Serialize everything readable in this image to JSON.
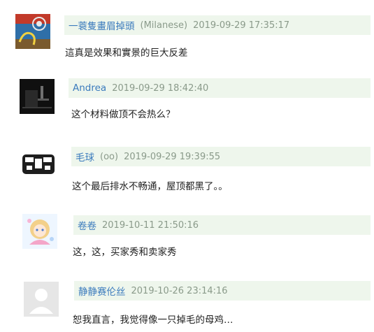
{
  "comments": [
    {
      "name": "一蓑隻畫眉掉頭",
      "nick": "(Milanese)",
      "time": "2019-09-29 17:35:17",
      "text": "這真是效果和實景的巨大反差",
      "avatar": "blue-bicycle-avatar"
    },
    {
      "name": "Andrea",
      "nick": "",
      "time": "2019-09-29 18:42:40",
      "text": "这个材料做顶不会热么？",
      "avatar": "dark-room-avatar"
    },
    {
      "name": "毛球",
      "nick": "(oo)",
      "time": "2019-09-29 19:39:55",
      "text": "这个最后排水不畅通，屋顶都黑了。。",
      "avatar": "black-logo-avatar"
    },
    {
      "name": "卷卷",
      "nick": "",
      "time": "2019-10-11 21:50:16",
      "text": "这，这，买家秀和卖家秀",
      "avatar": "anime-girl-avatar"
    },
    {
      "name": "静静赛伦丝",
      "nick": "",
      "time": "2019-10-26 23:14:16",
      "text": "恕我直言，我觉得像一只掉毛的母鸡…",
      "avatar": "default-user-avatar"
    }
  ]
}
